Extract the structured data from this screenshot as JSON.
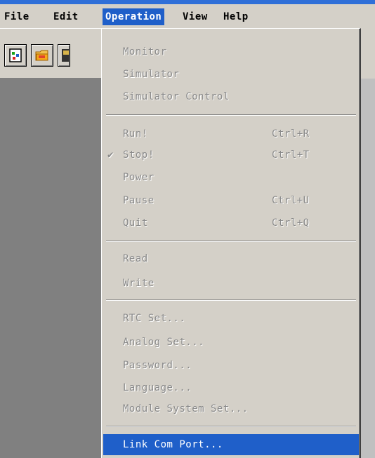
{
  "menubar": {
    "file": "File",
    "edit": "Edit",
    "operation": "Operation",
    "view": "View",
    "help": "Help"
  },
  "toolbar": {
    "buttons": [
      "new-icon",
      "open-icon",
      "save-icon"
    ]
  },
  "operation_menu": {
    "monitor": "Monitor",
    "simulator": "Simulator",
    "simulator_control": "Simulator Control",
    "run": "Run!",
    "run_shortcut": "Ctrl+R",
    "stop": "Stop!",
    "stop_shortcut": "Ctrl+T",
    "stop_check": "✔",
    "power": "Power",
    "pause": "Pause",
    "pause_shortcut": "Ctrl+U",
    "quit": "Quit",
    "quit_shortcut": "Ctrl+Q",
    "read": "Read",
    "write": "Write",
    "rtc_set": "RTC Set...",
    "analog_set": "Analog Set...",
    "password": "Password...",
    "language": "Language...",
    "module_system_set": "Module System Set...",
    "link_com_port": "Link Com Port..."
  },
  "colors": {
    "menu_highlight": "#1f5fc9",
    "face": "#d4d0c8",
    "workspace": "#808080",
    "disabled_text": "#8a8a8a"
  }
}
